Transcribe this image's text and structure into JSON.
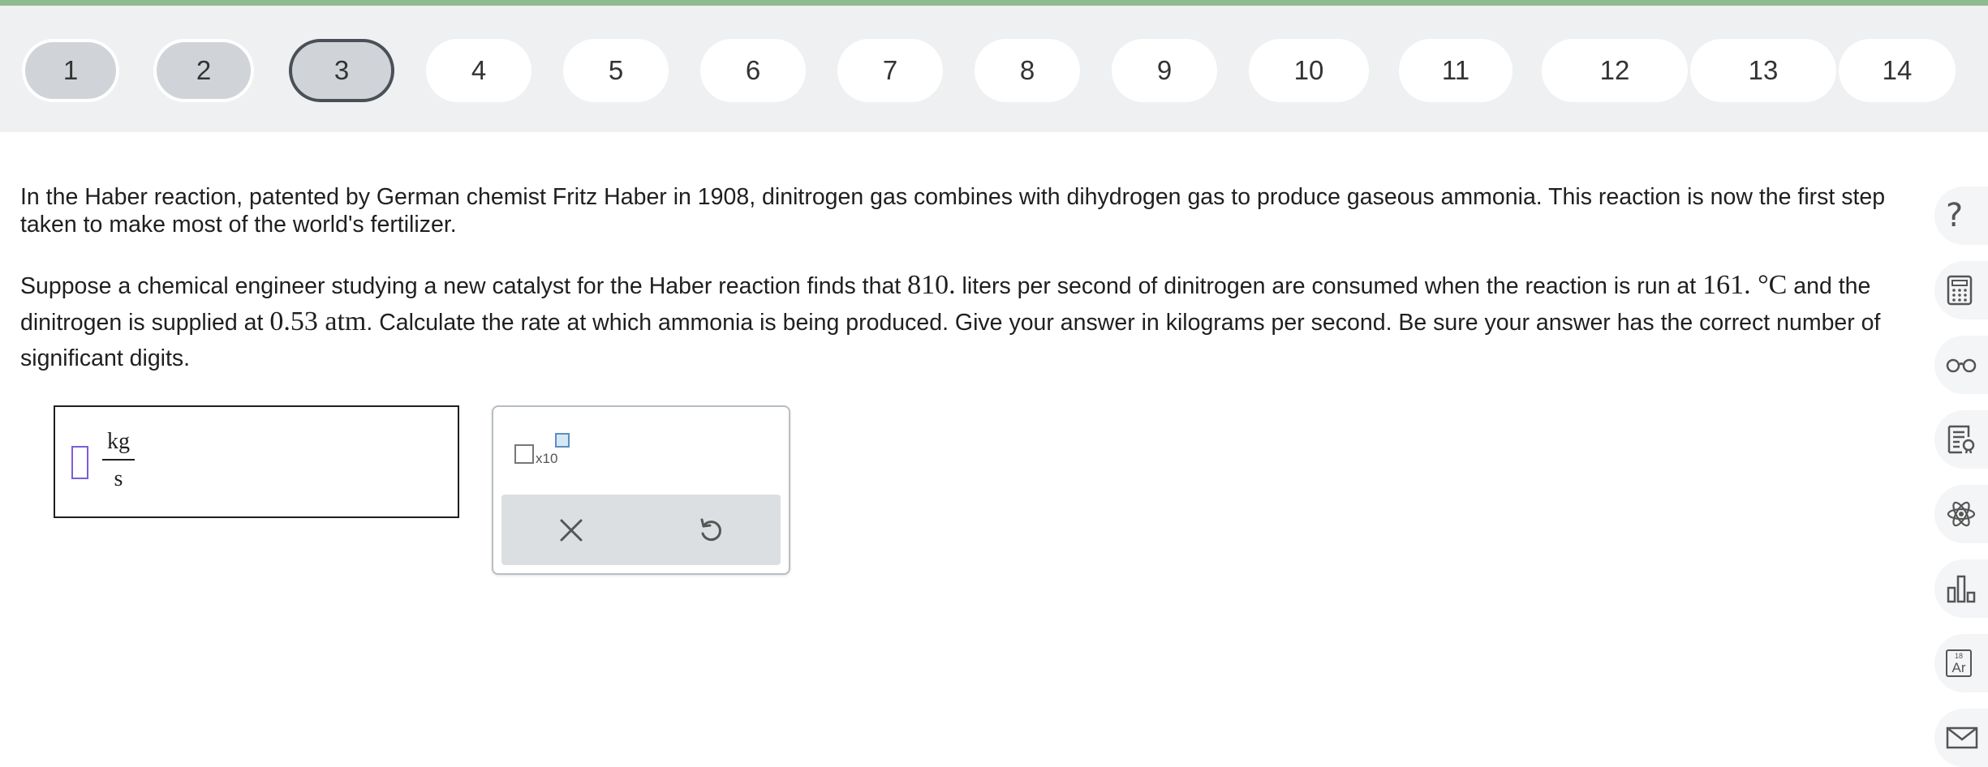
{
  "nav": {
    "questions": [
      {
        "label": "1",
        "state": "done"
      },
      {
        "label": "2",
        "state": "done"
      },
      {
        "label": "3",
        "state": "current"
      },
      {
        "label": "4",
        "state": "open"
      },
      {
        "label": "5",
        "state": "open"
      },
      {
        "label": "6",
        "state": "open"
      },
      {
        "label": "7",
        "state": "open"
      },
      {
        "label": "8",
        "state": "open"
      },
      {
        "label": "9",
        "state": "open"
      },
      {
        "label": "10",
        "state": "open"
      },
      {
        "label": "11",
        "state": "open"
      },
      {
        "label": "12",
        "state": "open"
      },
      {
        "label": "13",
        "state": "open"
      },
      {
        "label": "14",
        "state": "open"
      }
    ]
  },
  "question": {
    "intro": "In the Haber reaction, patented by German chemist Fritz Haber in 1908, dinitrogen gas combines with dihydrogen gas to produce gaseous ammonia. This reaction is now the first step taken to make most of the world's fertilizer.",
    "part1": "Suppose a chemical engineer studying a new catalyst for the Haber reaction finds that ",
    "flow_value": "810.",
    "part2": " liters per second of dinitrogen are consumed when the reaction is run at ",
    "temp_value": "161.",
    "temp_unit": " °C",
    "part3": " and the dinitrogen is supplied at ",
    "pressure_value": "0.53",
    "pressure_unit": " atm",
    "part4": ". Calculate the rate at which ammonia is being produced. Give your answer in kilograms per second. Be sure your answer has the correct number of significant digits."
  },
  "answer": {
    "value": "",
    "unit_numerator": "kg",
    "unit_denominator": "s"
  },
  "tools": {
    "sci_notation_label": "x10",
    "clear_icon": "close-icon",
    "undo_icon": "undo-icon"
  },
  "side_toolbar": {
    "items": [
      "help-icon",
      "calculator-icon",
      "glasses-icon",
      "data-sheet-icon",
      "atom-icon",
      "bar-chart-icon",
      "periodic-table-icon",
      "mail-icon"
    ],
    "element_number": "18",
    "element_symbol": "Ar"
  },
  "colors": {
    "top_stripe": "#8fbc8f",
    "answer_slot": "#7b5fd8",
    "nav_background": "#eff0f1"
  }
}
